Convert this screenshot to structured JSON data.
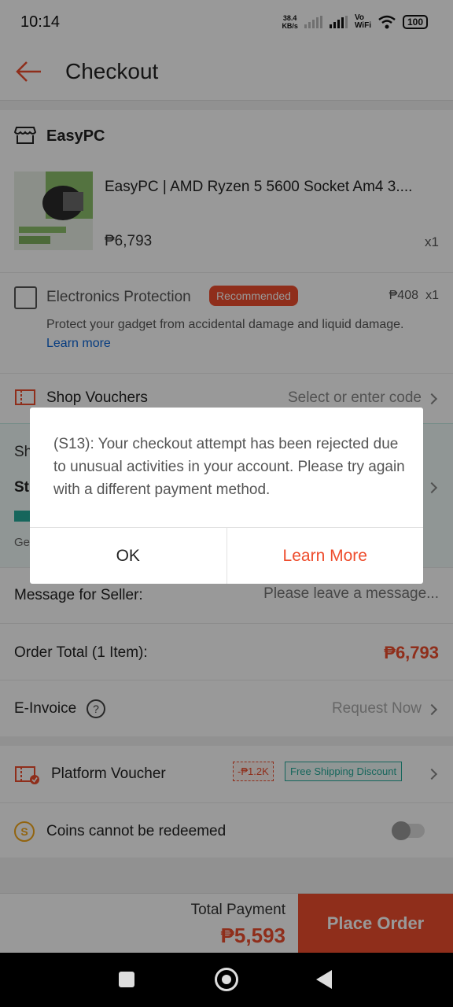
{
  "status_bar": {
    "time": "10:14",
    "net_speed_value": "38.4",
    "net_speed_unit": "KB/s",
    "vo_label": "Vo",
    "wifi_label": "WiFi",
    "battery": "100"
  },
  "header": {
    "title": "Checkout"
  },
  "shop": {
    "name": "EasyPC"
  },
  "product": {
    "title": "EasyPC | AMD Ryzen 5 5600 Socket Am4 3....",
    "price": "₱6,793",
    "quantity": "x1"
  },
  "protection": {
    "title": "Electronics Protection",
    "badge": "Recommended",
    "price": "₱408",
    "quantity": "x1",
    "description": "Protect your gadget from accidental damage and liquid damage.",
    "learn_more": "Learn more"
  },
  "shop_vouchers": {
    "label": "Shop Vouchers",
    "hint": "Select or enter code"
  },
  "shipping": {
    "label": "Sh",
    "bold": "St",
    "note": "Ge"
  },
  "message": {
    "label": "Message for Seller:",
    "placeholder": "Please leave a message..."
  },
  "order_total": {
    "label": "Order Total (1 Item):",
    "value": "₱6,793"
  },
  "einvoice": {
    "label": "E-Invoice",
    "help": "?",
    "action": "Request Now"
  },
  "platform_voucher": {
    "label": "Platform Voucher",
    "discount_tag": "-₱1.2K",
    "shipping_tag": "Free Shipping Discount"
  },
  "coins": {
    "icon": "S",
    "label": "Coins cannot be redeemed"
  },
  "footer": {
    "total_label": "Total Payment",
    "total_value": "₱5,593",
    "place_order": "Place Order"
  },
  "dialog": {
    "message": "(S13): Your checkout attempt has been rejected due to unusual activities in your account. Please try again with a different payment method.",
    "ok": "OK",
    "learn_more": "Learn More"
  },
  "colors": {
    "brand": "#ee4d2d",
    "teal": "#26aa99",
    "link": "#0b64d6"
  },
  "icons": [
    "back-arrow-icon",
    "shop-icon",
    "voucher-icon",
    "help-icon",
    "platform-voucher-icon",
    "coin-icon",
    "chevron-right-icon",
    "wifi-icon",
    "signal-icon",
    "battery-icon"
  ]
}
